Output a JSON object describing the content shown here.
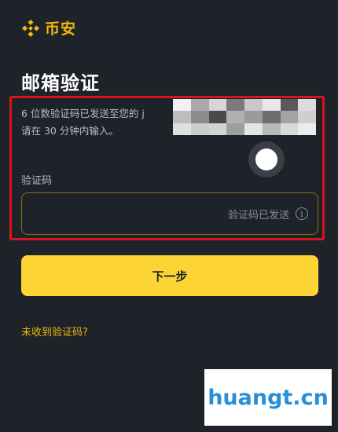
{
  "brand": {
    "name": "币安",
    "color": "#f0b90b"
  },
  "page": {
    "title": "邮箱验证"
  },
  "verification": {
    "message_line1": "6 位数验证码已发送至您的",
    "message_line2": "请在 30 分钟内输入。",
    "partial_char": "j",
    "email_redacted": true
  },
  "code_field": {
    "label": "验证码",
    "value": "",
    "status_text": "验证码已发送",
    "info_icon": "info-icon"
  },
  "actions": {
    "next_label": "下一步",
    "no_code_label": "未收到验证码?"
  },
  "watermark": {
    "text": "huangt.cn"
  },
  "colors": {
    "background": "#1e2329",
    "accent": "#fcd535",
    "highlight": "#d9141a",
    "link": "#f0b90b"
  }
}
